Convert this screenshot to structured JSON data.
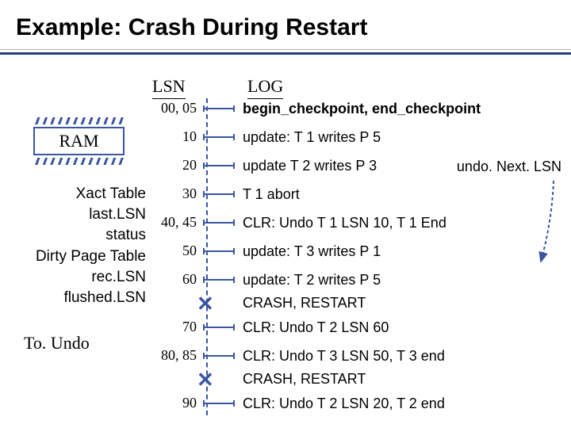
{
  "title": "Example: Crash During Restart",
  "ram_label": "RAM",
  "left_items": [
    "Xact Table",
    "last.LSN",
    "status",
    "Dirty Page Table",
    "rec.LSN",
    "flushed.LSN"
  ],
  "toundo_label": "To. Undo",
  "header": {
    "lsn": "LSN",
    "log": "LOG"
  },
  "undo_next_label": "undo. Next. LSN",
  "entries": [
    {
      "lsn": "00, 05",
      "msg": "begin_checkpoint, end_checkpoint",
      "bold": true
    },
    {
      "lsn": "10",
      "msg": "update: T 1 writes P 5"
    },
    {
      "lsn": "20",
      "msg": "update T 2 writes P 3"
    },
    {
      "lsn": "30",
      "msg": "T 1 abort"
    },
    {
      "lsn": "40, 45",
      "msg": "CLR: Undo T 1 LSN 10, T 1 End"
    },
    {
      "lsn": "50",
      "msg": "update: T 3 writes P 1"
    },
    {
      "lsn": "60",
      "msg": "update: T 2 writes P 5"
    },
    {
      "crash": true,
      "msg": "CRASH, RESTART"
    },
    {
      "lsn": "70",
      "msg": "CLR: Undo T 2 LSN 60"
    },
    {
      "lsn": "80, 85",
      "msg": "CLR: Undo T 3 LSN 50, T 3 end"
    },
    {
      "crash": true,
      "msg": "CRASH, RESTART"
    },
    {
      "lsn": "90",
      "msg": "CLR: Undo T 2 LSN 20, T 2 end"
    }
  ]
}
